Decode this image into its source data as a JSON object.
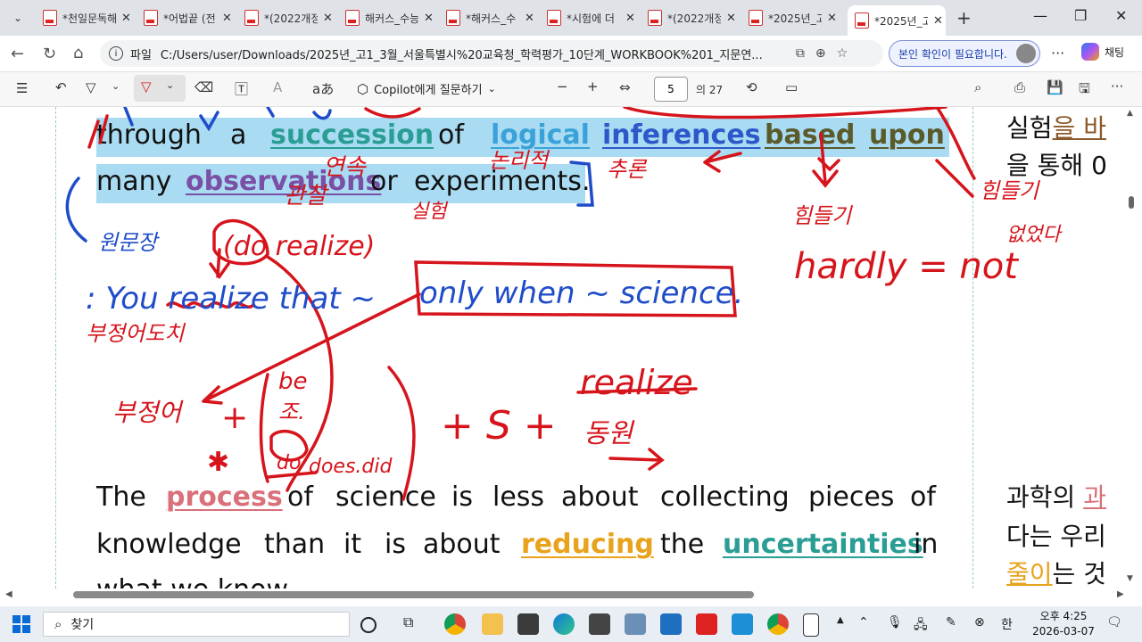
{
  "tabs": [
    {
      "title": "*천일문독해"
    },
    {
      "title": "*어법끝 (전"
    },
    {
      "title": "*(2022개정"
    },
    {
      "title": "해커스_수능"
    },
    {
      "title": "*해커스_수"
    },
    {
      "title": "*시험에 더"
    },
    {
      "title": "*(2022개정"
    },
    {
      "title": "*2025년_고"
    },
    {
      "title": "*2025년_고"
    }
  ],
  "address": {
    "label": "파일",
    "url": "C:/Users/user/Downloads/2025년_고1_3월_서울특별시%20교육청_학력평가_10단계_WORKBOOK%201_지문연...",
    "profile_label": "본인 확인이 필요합니다.",
    "chat_label": "채팅"
  },
  "pdf_toolbar": {
    "copilot_label": "Copilot에게 질문하기",
    "page_current": "5",
    "page_total": "의 27",
    "read_aloud_glyph": "aあ"
  },
  "document": {
    "line1": {
      "w1": "through",
      "w2": "a",
      "k1": "succession",
      "w3": "of",
      "k2": "logical",
      "k3": "inferences",
      "k4": "based",
      "k5": "upon"
    },
    "line2": {
      "w1": "many",
      "k1": "observations",
      "w2": "or",
      "w3": "experiments."
    },
    "line3": {
      "w1": "The",
      "k1": "process",
      "w2": "of",
      "w3": "science",
      "w4": "is",
      "w5": "less",
      "w6": "about",
      "w7": "collecting",
      "w8": "pieces",
      "w9": "of"
    },
    "line4": {
      "w1": "knowledge",
      "w2": "than",
      "w3": "it",
      "w4": "is",
      "w5": "about",
      "k1": "reducing",
      "w6": "the",
      "k2": "uncertainties",
      "w7": "in"
    },
    "line5": {
      "w1": "what we know."
    },
    "korean": {
      "r1a": "실험",
      "r1b": "을 바",
      "r2": "을 통해 0",
      "r3a": "과학의 ",
      "r3b": "과",
      "r4": "다는 우리",
      "r5a": "줄이",
      "r5b": "는 것"
    }
  },
  "annotations": {
    "yeonsok": "연속",
    "nolijeok": "논리적",
    "churon": "추론",
    "gwanchal": "관찰",
    "silheom": "실험",
    "hindeulgi": "힘들기",
    "hindeulgi2": "힘들기",
    "eobseossda": "없었다",
    "hardly": "hardly = not",
    "wonmunjang": "원문장",
    "do_realize": "(do realize)",
    "you_realize": ": You realize that ~",
    "only_when": "only when ~ science.",
    "bujeongeodochi": "부정어도치",
    "bujeonga": "부정어",
    "be": "be",
    "jo": "조.",
    "do": "do",
    "does_did": "does.did",
    "realize": "realize",
    "s_v": "+ S +",
    "dongwon": "동원"
  },
  "taskbar": {
    "search_label": "찾기",
    "time": "오후 4:25",
    "date": "2026-03-07",
    "ime": "한"
  }
}
